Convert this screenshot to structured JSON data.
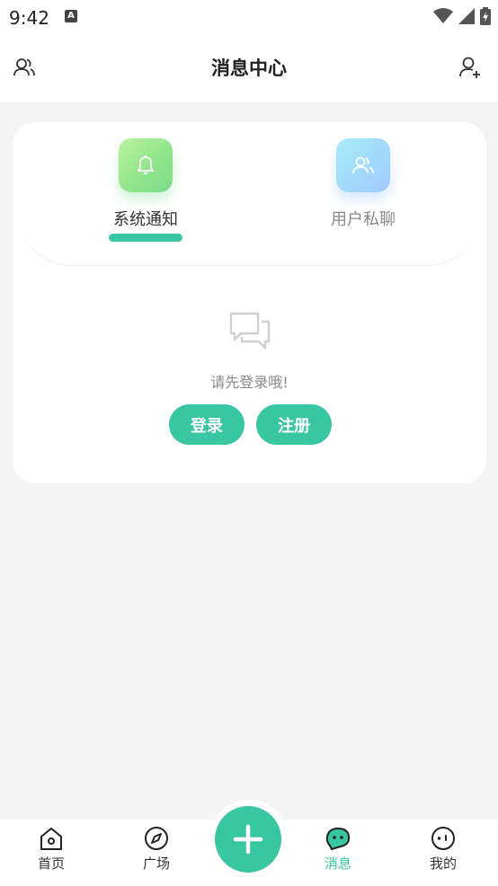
{
  "status_bar": {
    "time": "9:42",
    "notification_badge": "A",
    "icons": [
      "wifi-icon",
      "signal-icon",
      "battery-charging-icon"
    ]
  },
  "header": {
    "title": "消息中心",
    "left_icon": "contacts-icon",
    "right_icon": "add-user-icon"
  },
  "tabs": [
    {
      "label": "系统通知",
      "icon": "bell-icon",
      "active": true
    },
    {
      "label": "用户私聊",
      "icon": "users-icon",
      "active": false
    }
  ],
  "empty_state": {
    "icon": "chat-bubbles-icon",
    "message": "请先登录哦!",
    "login_label": "登录",
    "register_label": "注册"
  },
  "bottom_nav": {
    "items": [
      {
        "label": "首页",
        "icon": "home-icon",
        "active": false
      },
      {
        "label": "广场",
        "icon": "compass-icon",
        "active": false
      },
      {
        "label": "消息",
        "icon": "message-icon",
        "active": true
      },
      {
        "label": "我的",
        "icon": "profile-face-icon",
        "active": false
      }
    ],
    "center_icon": "plus-icon"
  },
  "colors": {
    "accent": "#39c6a2",
    "background": "#f4f4f4",
    "card": "#ffffff"
  }
}
